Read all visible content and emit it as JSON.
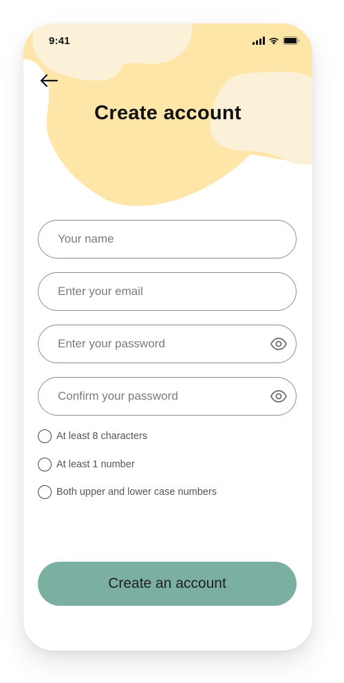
{
  "status_bar": {
    "time": "9:41",
    "icons": [
      "signal-icon",
      "wifi-icon",
      "battery-icon"
    ]
  },
  "header": {
    "back_icon": "arrow-left-icon",
    "title": "Create account"
  },
  "form": {
    "name": {
      "placeholder": "Your name",
      "value": ""
    },
    "email": {
      "placeholder": "Enter your email",
      "value": ""
    },
    "password": {
      "placeholder": "Enter your password",
      "value": "",
      "icon": "eye-icon"
    },
    "confirm_password": {
      "placeholder": "Confirm your password",
      "value": "",
      "icon": "eye-icon"
    }
  },
  "requirements": [
    {
      "label": "At least 8 characters",
      "checked": false
    },
    {
      "label": "At least 1 number",
      "checked": false
    },
    {
      "label": "Both upper and lower case numbers",
      "checked": false
    }
  ],
  "cta": {
    "label": "Create an account"
  },
  "colors": {
    "blob_primary": "#fde6a8",
    "blob_secondary": "#fbf0d8",
    "cta_background": "#7aafa1",
    "field_border": "#8d8d8d",
    "text_primary": "#111111"
  }
}
